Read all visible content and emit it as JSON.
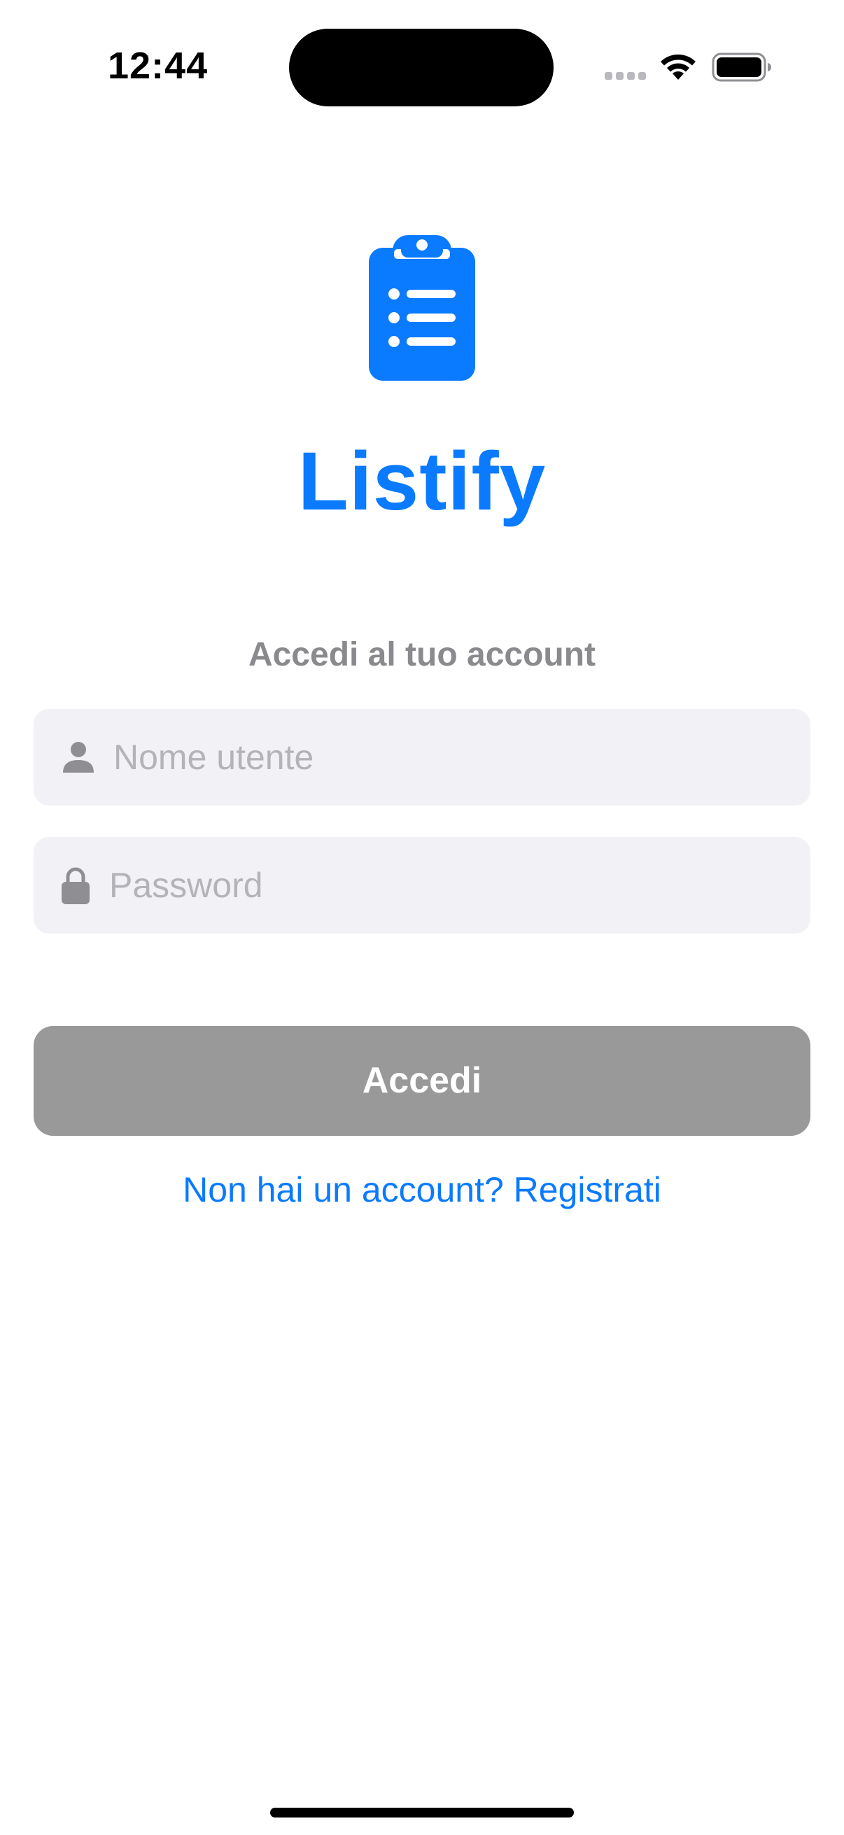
{
  "status_bar": {
    "time": "12:44",
    "icons": [
      "cellular-signal-icon",
      "wifi-icon",
      "battery-icon"
    ]
  },
  "app": {
    "logo_icon": "clipboard-list-icon",
    "title": "Listify",
    "accent_color": "#0a7aff"
  },
  "login": {
    "subtitle": "Accedi al tuo account",
    "username": {
      "icon": "person-icon",
      "placeholder": "Nome utente",
      "value": ""
    },
    "password": {
      "icon": "lock-icon",
      "placeholder": "Password",
      "value": ""
    },
    "submit_label": "Accedi",
    "submit_color": "#999999",
    "register_link": "Non hai un account? Registrati"
  }
}
